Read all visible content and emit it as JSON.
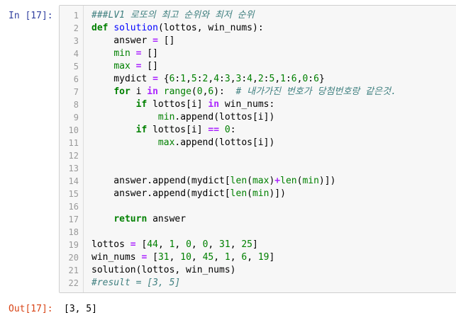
{
  "input_prompt": "In [17]:",
  "output_prompt": "Out[17]:",
  "output_value": "[3, 5]",
  "code_lines": [
    {
      "n": "1",
      "tokens": [
        {
          "t": "###LV1 로또의 최고 순위와 최저 순위",
          "c": "tok-comment"
        }
      ]
    },
    {
      "n": "2",
      "tokens": [
        {
          "t": "def",
          "c": "tok-kw"
        },
        {
          "t": " ",
          "c": "tok-text"
        },
        {
          "t": "solution",
          "c": "tok-def"
        },
        {
          "t": "(lottos, win_nums):",
          "c": "tok-text"
        }
      ]
    },
    {
      "n": "3",
      "tokens": [
        {
          "t": "    answer ",
          "c": "tok-text"
        },
        {
          "t": "=",
          "c": "tok-op"
        },
        {
          "t": " []",
          "c": "tok-text"
        }
      ]
    },
    {
      "n": "4",
      "tokens": [
        {
          "t": "    ",
          "c": "tok-text"
        },
        {
          "t": "min",
          "c": "tok-builtin"
        },
        {
          "t": " ",
          "c": "tok-text"
        },
        {
          "t": "=",
          "c": "tok-op"
        },
        {
          "t": " []",
          "c": "tok-text"
        }
      ]
    },
    {
      "n": "5",
      "tokens": [
        {
          "t": "    ",
          "c": "tok-text"
        },
        {
          "t": "max",
          "c": "tok-builtin"
        },
        {
          "t": " ",
          "c": "tok-text"
        },
        {
          "t": "=",
          "c": "tok-op"
        },
        {
          "t": " []",
          "c": "tok-text"
        }
      ]
    },
    {
      "n": "6",
      "tokens": [
        {
          "t": "    mydict ",
          "c": "tok-text"
        },
        {
          "t": "=",
          "c": "tok-op"
        },
        {
          "t": " {",
          "c": "tok-text"
        },
        {
          "t": "6",
          "c": "tok-num"
        },
        {
          "t": ":",
          "c": "tok-text"
        },
        {
          "t": "1",
          "c": "tok-num"
        },
        {
          "t": ",",
          "c": "tok-text"
        },
        {
          "t": "5",
          "c": "tok-num"
        },
        {
          "t": ":",
          "c": "tok-text"
        },
        {
          "t": "2",
          "c": "tok-num"
        },
        {
          "t": ",",
          "c": "tok-text"
        },
        {
          "t": "4",
          "c": "tok-num"
        },
        {
          "t": ":",
          "c": "tok-text"
        },
        {
          "t": "3",
          "c": "tok-num"
        },
        {
          "t": ",",
          "c": "tok-text"
        },
        {
          "t": "3",
          "c": "tok-num"
        },
        {
          "t": ":",
          "c": "tok-text"
        },
        {
          "t": "4",
          "c": "tok-num"
        },
        {
          "t": ",",
          "c": "tok-text"
        },
        {
          "t": "2",
          "c": "tok-num"
        },
        {
          "t": ":",
          "c": "tok-text"
        },
        {
          "t": "5",
          "c": "tok-num"
        },
        {
          "t": ",",
          "c": "tok-text"
        },
        {
          "t": "1",
          "c": "tok-num"
        },
        {
          "t": ":",
          "c": "tok-text"
        },
        {
          "t": "6",
          "c": "tok-num"
        },
        {
          "t": ",",
          "c": "tok-text"
        },
        {
          "t": "0",
          "c": "tok-num"
        },
        {
          "t": ":",
          "c": "tok-text"
        },
        {
          "t": "6",
          "c": "tok-num"
        },
        {
          "t": "}",
          "c": "tok-text"
        }
      ]
    },
    {
      "n": "7",
      "tokens": [
        {
          "t": "    ",
          "c": "tok-text"
        },
        {
          "t": "for",
          "c": "tok-kw"
        },
        {
          "t": " i ",
          "c": "tok-text"
        },
        {
          "t": "in",
          "c": "tok-op"
        },
        {
          "t": " ",
          "c": "tok-text"
        },
        {
          "t": "range",
          "c": "tok-builtin"
        },
        {
          "t": "(",
          "c": "tok-text"
        },
        {
          "t": "0",
          "c": "tok-num"
        },
        {
          "t": ",",
          "c": "tok-text"
        },
        {
          "t": "6",
          "c": "tok-num"
        },
        {
          "t": "):  ",
          "c": "tok-text"
        },
        {
          "t": "# 내가가진 번호가 당첨번호랑 같은것.",
          "c": "tok-comment"
        }
      ]
    },
    {
      "n": "8",
      "tokens": [
        {
          "t": "        ",
          "c": "tok-text"
        },
        {
          "t": "if",
          "c": "tok-kw"
        },
        {
          "t": " lottos[i] ",
          "c": "tok-text"
        },
        {
          "t": "in",
          "c": "tok-op"
        },
        {
          "t": " win_nums:",
          "c": "tok-text"
        }
      ]
    },
    {
      "n": "9",
      "tokens": [
        {
          "t": "            ",
          "c": "tok-text"
        },
        {
          "t": "min",
          "c": "tok-builtin"
        },
        {
          "t": ".append(lottos[i])",
          "c": "tok-text"
        }
      ]
    },
    {
      "n": "10",
      "tokens": [
        {
          "t": "        ",
          "c": "tok-text"
        },
        {
          "t": "if",
          "c": "tok-kw"
        },
        {
          "t": " lottos[i] ",
          "c": "tok-text"
        },
        {
          "t": "==",
          "c": "tok-op"
        },
        {
          "t": " ",
          "c": "tok-text"
        },
        {
          "t": "0",
          "c": "tok-num"
        },
        {
          "t": ":",
          "c": "tok-text"
        }
      ]
    },
    {
      "n": "11",
      "tokens": [
        {
          "t": "            ",
          "c": "tok-text"
        },
        {
          "t": "max",
          "c": "tok-builtin"
        },
        {
          "t": ".append(lottos[i])",
          "c": "tok-text"
        }
      ]
    },
    {
      "n": "12",
      "tokens": []
    },
    {
      "n": "13",
      "tokens": []
    },
    {
      "n": "14",
      "tokens": [
        {
          "t": "    answer.append(mydict[",
          "c": "tok-text"
        },
        {
          "t": "len",
          "c": "tok-builtin"
        },
        {
          "t": "(",
          "c": "tok-text"
        },
        {
          "t": "max",
          "c": "tok-builtin"
        },
        {
          "t": ")",
          "c": "tok-text"
        },
        {
          "t": "+",
          "c": "tok-op"
        },
        {
          "t": "len",
          "c": "tok-builtin"
        },
        {
          "t": "(",
          "c": "tok-text"
        },
        {
          "t": "min",
          "c": "tok-builtin"
        },
        {
          "t": ")])",
          "c": "tok-text"
        }
      ]
    },
    {
      "n": "15",
      "tokens": [
        {
          "t": "    answer.append(mydict[",
          "c": "tok-text"
        },
        {
          "t": "len",
          "c": "tok-builtin"
        },
        {
          "t": "(",
          "c": "tok-text"
        },
        {
          "t": "min",
          "c": "tok-builtin"
        },
        {
          "t": ")])",
          "c": "tok-text"
        }
      ]
    },
    {
      "n": "16",
      "tokens": []
    },
    {
      "n": "17",
      "tokens": [
        {
          "t": "    ",
          "c": "tok-text"
        },
        {
          "t": "return",
          "c": "tok-kw"
        },
        {
          "t": " answer",
          "c": "tok-text"
        }
      ]
    },
    {
      "n": "18",
      "tokens": []
    },
    {
      "n": "19",
      "tokens": [
        {
          "t": "lottos ",
          "c": "tok-text"
        },
        {
          "t": "=",
          "c": "tok-op"
        },
        {
          "t": " [",
          "c": "tok-text"
        },
        {
          "t": "44",
          "c": "tok-num"
        },
        {
          "t": ", ",
          "c": "tok-text"
        },
        {
          "t": "1",
          "c": "tok-num"
        },
        {
          "t": ", ",
          "c": "tok-text"
        },
        {
          "t": "0",
          "c": "tok-num"
        },
        {
          "t": ", ",
          "c": "tok-text"
        },
        {
          "t": "0",
          "c": "tok-num"
        },
        {
          "t": ", ",
          "c": "tok-text"
        },
        {
          "t": "31",
          "c": "tok-num"
        },
        {
          "t": ", ",
          "c": "tok-text"
        },
        {
          "t": "25",
          "c": "tok-num"
        },
        {
          "t": "]",
          "c": "tok-text"
        }
      ]
    },
    {
      "n": "20",
      "tokens": [
        {
          "t": "win_nums ",
          "c": "tok-text"
        },
        {
          "t": "=",
          "c": "tok-op"
        },
        {
          "t": " [",
          "c": "tok-text"
        },
        {
          "t": "31",
          "c": "tok-num"
        },
        {
          "t": ", ",
          "c": "tok-text"
        },
        {
          "t": "10",
          "c": "tok-num"
        },
        {
          "t": ", ",
          "c": "tok-text"
        },
        {
          "t": "45",
          "c": "tok-num"
        },
        {
          "t": ", ",
          "c": "tok-text"
        },
        {
          "t": "1",
          "c": "tok-num"
        },
        {
          "t": ", ",
          "c": "tok-text"
        },
        {
          "t": "6",
          "c": "tok-num"
        },
        {
          "t": ", ",
          "c": "tok-text"
        },
        {
          "t": "19",
          "c": "tok-num"
        },
        {
          "t": "]",
          "c": "tok-text"
        }
      ]
    },
    {
      "n": "21",
      "tokens": [
        {
          "t": "solution(lottos, win_nums)",
          "c": "tok-text"
        }
      ]
    },
    {
      "n": "22",
      "tokens": [
        {
          "t": "#result = [3, 5]",
          "c": "tok-comment"
        }
      ]
    }
  ]
}
